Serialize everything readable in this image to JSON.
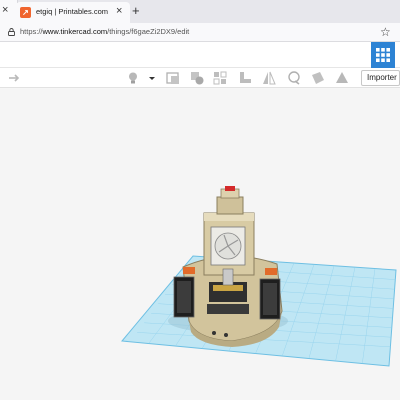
{
  "browser": {
    "tab": {
      "title": "etgiq | Printables.com",
      "favicon": "printables-icon",
      "favicon_glyph": "↗"
    },
    "new_tab_glyph": "+",
    "close_glyph": "×",
    "address": {
      "scheme": "https://",
      "host": "www.tinkercad.com",
      "path": "/things/f6gaeZi2DX9/edit"
    },
    "bookmark_icon": "star-icon"
  },
  "tinkercad": {
    "header": {
      "menu_icon": "grid-menu-icon",
      "accent": "#2d83d4"
    },
    "toolbar": {
      "tools": [
        "redo-icon",
        "lightbulb-icon",
        "dropdown-arrow-icon",
        "view-icon",
        "shapes-icon",
        "align-icon",
        "workplane-icon",
        "mirror-icon",
        "ruler-icon",
        "notes-icon",
        "group-icon"
      ],
      "importer_label": "Importer"
    }
  },
  "scene": {
    "model": "3d-model",
    "colors": {
      "workplane": "#a9dcef",
      "grid": "#79c6e6",
      "body": "#d8cba4",
      "red_button": "#d42a2a",
      "orange_accent": "#e26b2a"
    }
  }
}
